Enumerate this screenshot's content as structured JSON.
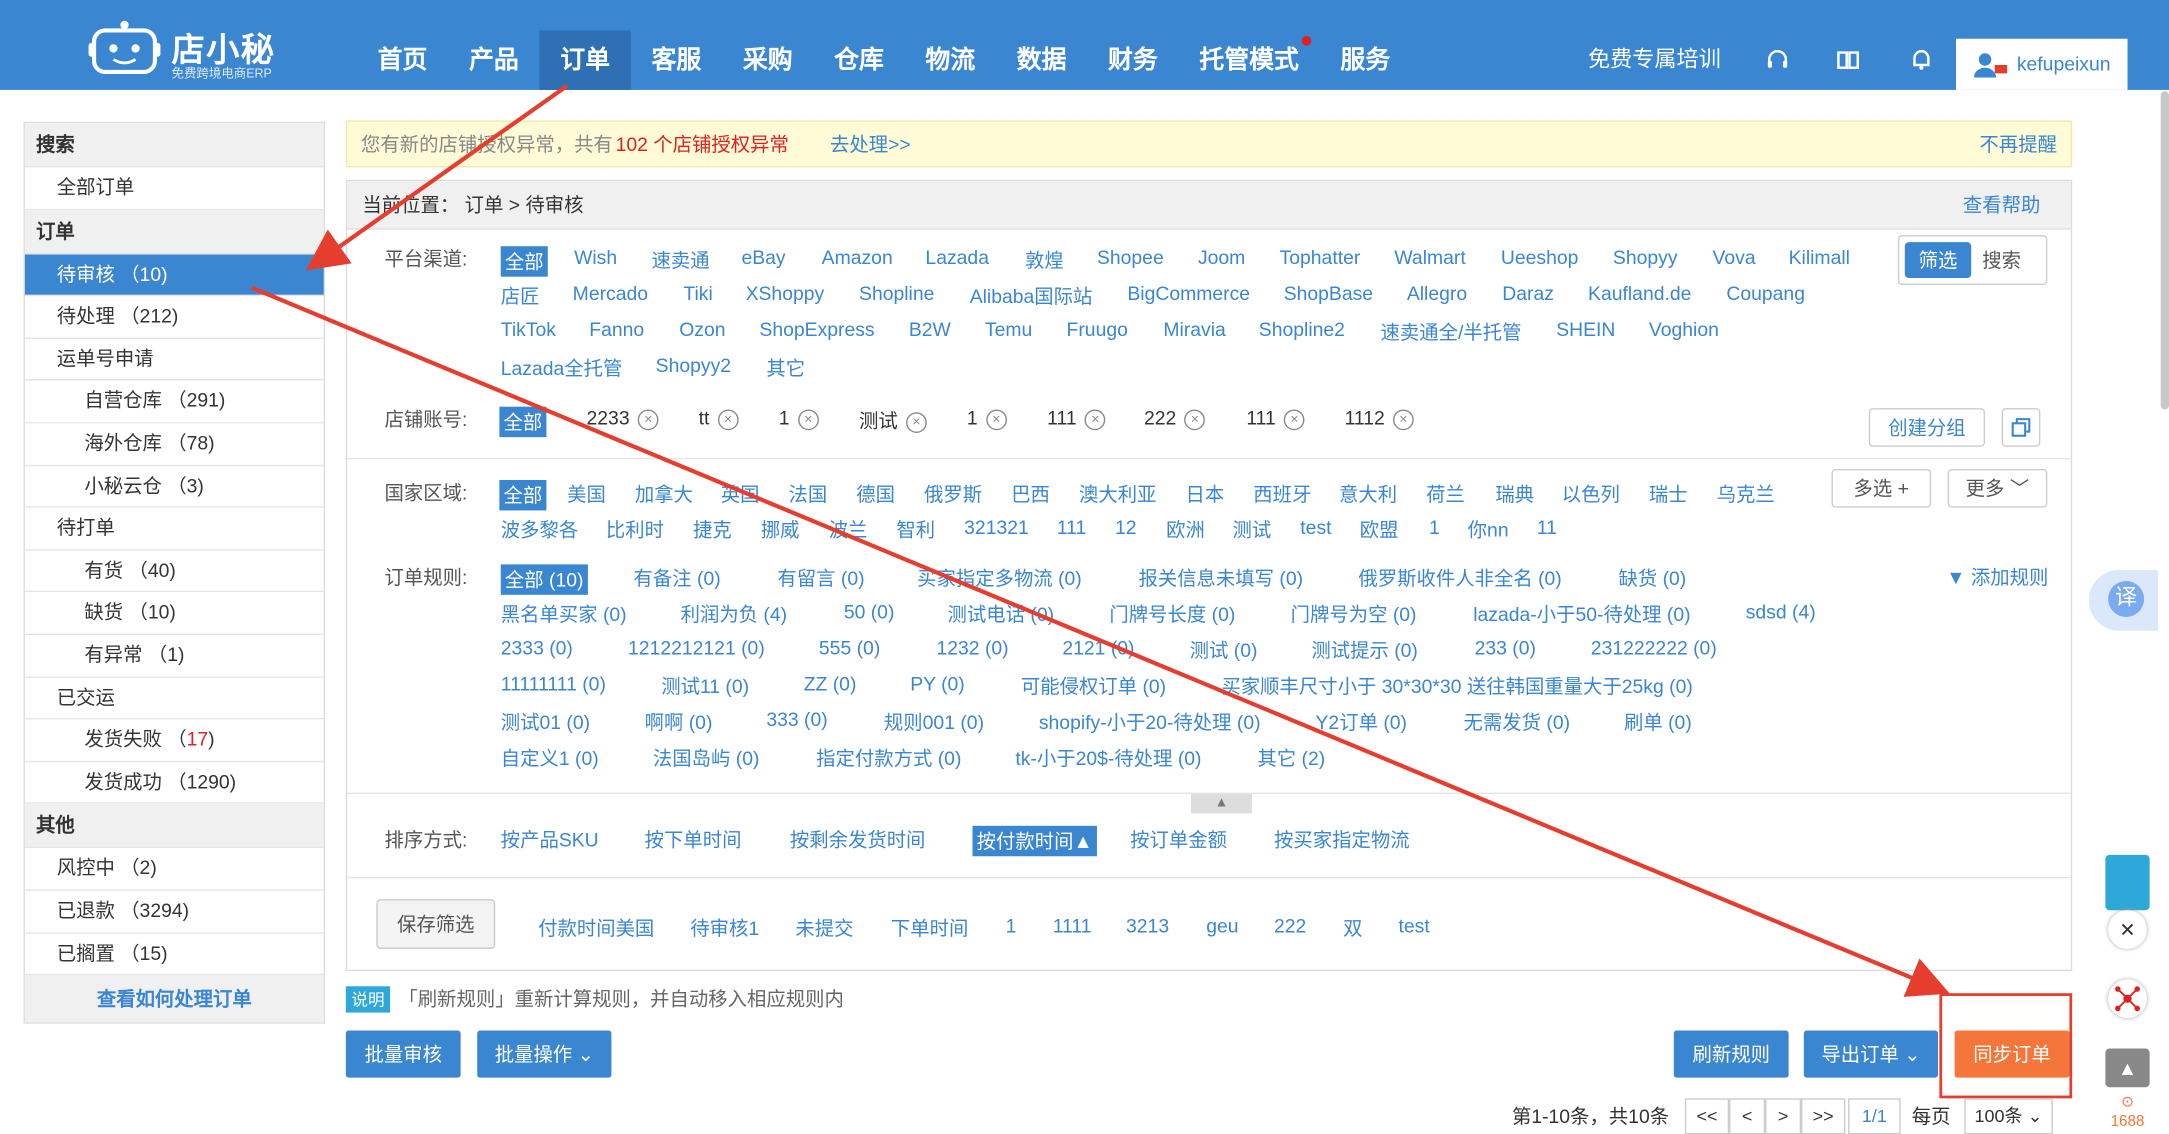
{
  "header": {
    "logo_name": "店小秘",
    "logo_sub": "免费跨境电商ERP",
    "nav": [
      "首页",
      "产品",
      "订单",
      "客服",
      "采购",
      "仓库",
      "物流",
      "数据",
      "财务",
      "托管模式",
      "服务"
    ],
    "training": "免费专属培训",
    "username": "kefupeixun"
  },
  "sidebar": {
    "search_head": "搜索",
    "all_orders": "全部订单",
    "order_head": "订单",
    "pending_review": "待审核 （10)",
    "pending": "待处理 （212)",
    "waybill": "运单号申请",
    "own_wh": "自营仓库 （291)",
    "overseas_wh": "海外仓库 （78)",
    "cloud_wh": "小秘云仓 （3)",
    "to_print": "待打单",
    "in_stock": "有货 （40)",
    "out_stock": "缺货 （10)",
    "abnormal": "有异常 （1)",
    "shipped": "已交运",
    "ship_fail": "发货失败 （",
    "ship_fail_num": "17",
    "ship_fail_end": ")",
    "ship_ok": "发货成功 （1290)",
    "other_head": "其他",
    "risk": "风控中 （2)",
    "refunded": "已退款 （3294)",
    "shelved": "已搁置 （15)",
    "help_link": "查看如何处理订单"
  },
  "notice": {
    "text": "您有新的店铺授权异常，共有",
    "count": "102 个店铺授权异常",
    "action": "去处理>>",
    "dismiss": "不再提醒"
  },
  "breadcrumb": {
    "location": "当前位置： 订单 > 待审核",
    "help": "查看帮助"
  },
  "platform": {
    "label": "平台渠道:",
    "items": [
      "全部",
      "Wish",
      "速卖通",
      "eBay",
      "Amazon",
      "Lazada",
      "敦煌",
      "Shopee",
      "Joom",
      "Tophatter",
      "Walmart",
      "Ueeshop",
      "Shopyy",
      "Vova",
      "Kilimall",
      "店匠",
      "Mercado",
      "Tiki",
      "XShoppy",
      "Shopline",
      "Alibaba国际站",
      "BigCommerce",
      "ShopBase",
      "Allegro",
      "Daraz",
      "Kaufland.de",
      "Coupang",
      "TikTok",
      "Fanno",
      "Ozon",
      "ShopExpress",
      "B2W",
      "Temu",
      "Fruugo",
      "Miravia",
      "Shopline2",
      "速卖通全/半托管",
      "SHEIN",
      "Voghion",
      "Lazada全托管",
      "Shopyy2",
      "其它"
    ],
    "filter_btn": "筛选",
    "search_btn": "搜索"
  },
  "store": {
    "label": "店铺账号:",
    "items": [
      "全部",
      "2233",
      "tt",
      "1",
      "测试",
      "1",
      "111",
      "222",
      "111",
      "1112"
    ],
    "create_group": "创建分组"
  },
  "country": {
    "label": "国家区域:",
    "items": [
      "全部",
      "美国",
      "加拿大",
      "英国",
      "法国",
      "德国",
      "俄罗斯",
      "巴西",
      "澳大利亚",
      "日本",
      "西班牙",
      "意大利",
      "荷兰",
      "瑞典",
      "以色列",
      "瑞士",
      "乌克兰",
      "波多黎各",
      "比利时",
      "捷克",
      "挪威",
      "波兰",
      "智利",
      "321321",
      "111",
      "12",
      "欧洲",
      "测试",
      "test",
      "欧盟",
      "1",
      "你nn",
      "11"
    ],
    "multi": "多选 +",
    "more": "更多"
  },
  "rules": {
    "label": "订单规则:",
    "items": [
      "全部 (10)",
      "有备注 (0)",
      "有留言 (0)",
      "买家指定多物流 (0)",
      "报关信息未填写 (0)",
      "俄罗斯收件人非全名 (0)",
      "缺货 (0)",
      "黑名单买家 (0)",
      "利润为负 (4)",
      "50 (0)",
      "测试电话 (0)",
      "门牌号长度 (0)",
      "门牌号为空 (0)",
      "lazada-小于50-待处理 (0)",
      "sdsd (4)",
      "2333 (0)",
      "1212212121 (0)",
      "555 (0)",
      "1232 (0)",
      "2121 (0)",
      "测试 (0)",
      "测试提示 (0)",
      "233 (0)",
      "231222222 (0)",
      "11111111 (0)",
      "测试11 (0)",
      "ZZ (0)",
      "PY (0)",
      "可能侵权订单 (0)",
      "买家顺丰尺寸小于 30*30*30 送往韩国重量大于25kg (0)",
      "测试01 (0)",
      "啊啊 (0)",
      "333 (0)",
      "规则001 (0)",
      "shopify-小于20-待处理 (0)",
      "Y2订单 (0)",
      "无需发货 (0)",
      "刷单 (0)",
      "自定义1 (0)",
      "法国岛屿 (0)",
      "指定付款方式 (0)",
      "tk-小于20$-待处理 (0)",
      "其它 (2)"
    ],
    "add_rule": "添加规则"
  },
  "sort": {
    "label": "排序方式:",
    "items": [
      "按产品SKU",
      "按下单时间",
      "按剩余发货时间",
      "按付款时间▲",
      "按订单金额",
      "按买家指定物流"
    ]
  },
  "saved": {
    "btn": "保存筛选",
    "items": [
      "付款时间美国",
      "待审核1",
      "未提交",
      "下单时间",
      "1",
      "1111",
      "3213",
      "geu",
      "222",
      "双",
      "test"
    ]
  },
  "tip": {
    "tag": "说明",
    "text": "「刷新规则」重新计算规则，并自动移入相应规则内"
  },
  "actions": {
    "batch_review": "批量审核",
    "batch_ops": "批量操作",
    "refresh_rules": "刷新规则",
    "export": "导出订单",
    "sync": "同步订单"
  },
  "pager": {
    "summary": "第1-10条，共10条",
    "first": "<<",
    "prev": "<",
    "next": ">",
    "last": ">>",
    "page": "1/1",
    "per_page_label": "每页",
    "per_page": "100条"
  },
  "float": {
    "translate": "译"
  },
  "colors": {
    "brand": "#3b86d1",
    "accent": "#f5763a",
    "annotation": "#e53d2e"
  }
}
